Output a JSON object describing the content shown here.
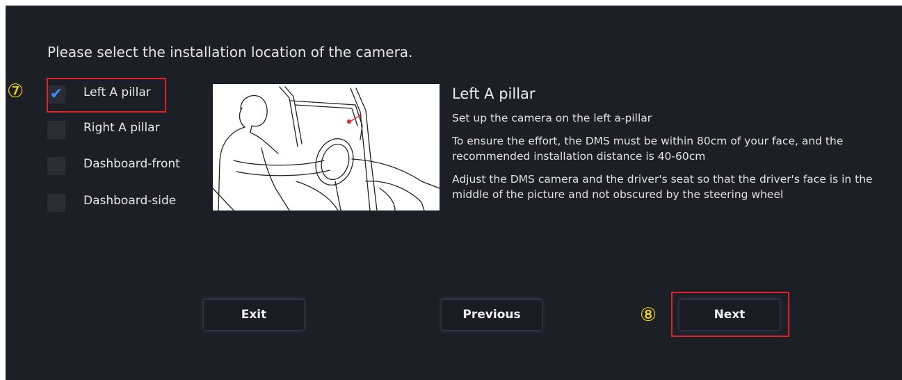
{
  "prompt": "Please select the installation location of the camera.",
  "options": [
    {
      "label": "Left A pillar",
      "checked": true,
      "check_glyph": "✔"
    },
    {
      "label": "Right A pillar",
      "checked": false
    },
    {
      "label": "Dashboard-front",
      "checked": false
    },
    {
      "label": "Dashboard-side",
      "checked": false
    }
  ],
  "detail": {
    "title": "Left A pillar",
    "paragraphs": [
      "Set up the camera on the left a-pillar",
      "To ensure the effort, the DMS must be within 80cm of your face, and the recommended installation distance is 40-60cm",
      "Adjust the DMS camera and the driver's seat so that the driver's face is in the middle of the picture and not obscured by the steering wheel"
    ]
  },
  "buttons": {
    "exit": "Exit",
    "previous": "Previous",
    "next": "Next"
  },
  "annotations": {
    "marker_7": "⑦",
    "marker_8": "⑧"
  },
  "colors": {
    "background": "#1d1f26",
    "highlight_box": "#e0232b",
    "marker": "#f6e010",
    "check": "#3b8ef7"
  }
}
